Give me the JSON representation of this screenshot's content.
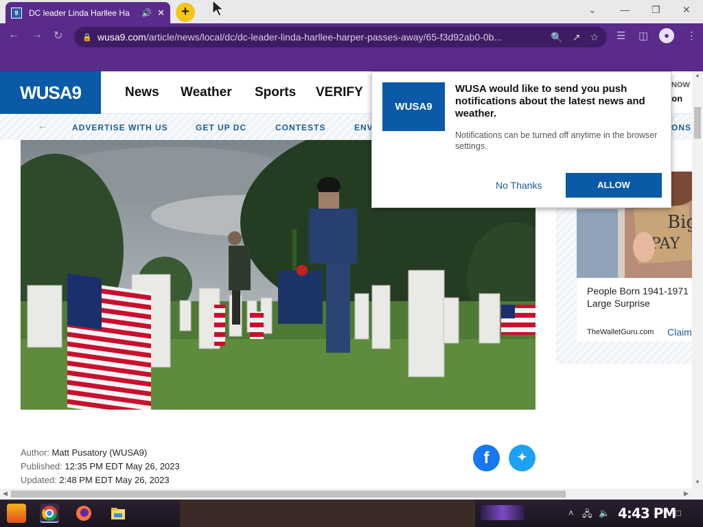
{
  "browser": {
    "tab_title": "DC leader Linda Harllee Ha",
    "tab_favicon": "wusa9-favicon",
    "new_tab_label": "+",
    "url_domain": "wusa9.com",
    "url_path": "/article/news/local/dc/dc-leader-linda-harllee-harper-passes-away/65-f3d92ab0-0b...",
    "accent_color": "#5a2b8a"
  },
  "site": {
    "logo_text": "WUSA9",
    "nav": [
      "News",
      "Weather",
      "Sports",
      "VERIFY"
    ],
    "top_right_1": "NOW",
    "top_right_2": "gton",
    "subnav": [
      "ADVERTISE WITH US",
      "GET UP DC",
      "CONTESTS",
      "ENV"
    ],
    "subnav_right": "ONS",
    "brand_color": "#0a5aa8"
  },
  "article": {
    "author_label": "Author:",
    "author": "Matt Pusatory (WUSA9)",
    "published_label": "Published:",
    "published": "12:35 PM EDT May 26, 2023",
    "updated_label": "Updated:",
    "updated": "2:48 PM EDT May 26, 2023"
  },
  "ad": {
    "sign_text": "Big PAY",
    "title_line1": "People Born 1941-1971",
    "title_line2": "Large Surprise",
    "source": "TheWalletGuru.com",
    "cta": "Claim"
  },
  "notification": {
    "logo_text": "WUSA9",
    "heading": "WUSA would like to send you push notifications about the latest news and weather.",
    "subtext": "Notifications can be turned off anytime in the browser settings.",
    "no_label": "No Thanks",
    "allow_label": "ALLOW"
  },
  "taskbar": {
    "clock": "4:43 PM"
  }
}
